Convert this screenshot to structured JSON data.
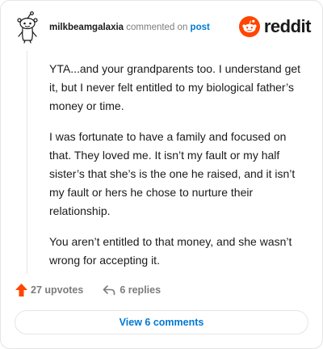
{
  "comment": {
    "username": "milkbeamgalaxia",
    "action_text": "commented on",
    "post_link_text": "post",
    "paragraphs": [
      "YTA...and your grandparents too. I understand get it, but I never felt entitled to my biological father’s money or time.",
      "I was fortunate to have a family and focused on that. They loved me. It isn’t my fault or my half sister’s that she’s is the one he raised, and it isn’t my fault or hers he chose to nurture their relationship.",
      "You aren’t entitled to that money, and she wasn’t wrong for accepting it."
    ],
    "upvotes_label": "27 upvotes",
    "replies_label": "6 replies",
    "view_comments_label": "View 6 comments"
  },
  "brand": {
    "name": "reddit",
    "icon": "reddit-snoo-logo"
  },
  "colors": {
    "reddit_orange": "#ff4500",
    "link_blue": "#0079d3",
    "muted_gray": "#7c7c7c",
    "border": "#e5e5e5"
  }
}
